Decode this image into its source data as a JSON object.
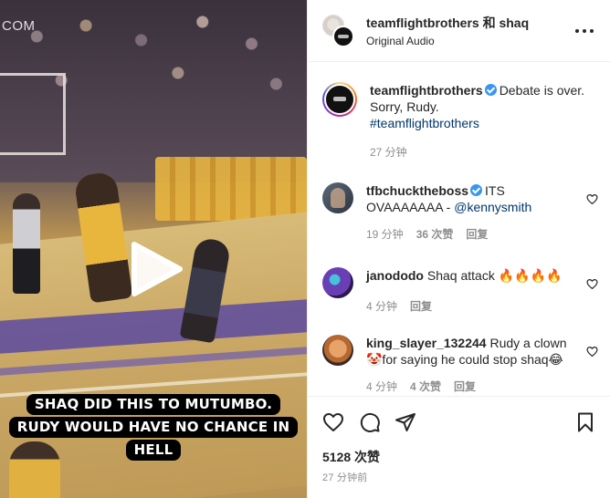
{
  "video": {
    "watermark": "COM",
    "caption_lines": [
      "SHAQ DID THIS TO MUTUMBO.",
      "RUDY WOULD HAVE NO CHANCE IN",
      "HELL"
    ]
  },
  "header": {
    "title": "teamflightbrothers 和 shaq",
    "subtitle": "Original Audio",
    "more_icon": "more-horizontal-icon"
  },
  "caption_post": {
    "username": "teamflightbrothers",
    "text": "Debate is over. Sorry, Rudy.",
    "hashtag": "#teamflightbrothers",
    "time": "27 分钟"
  },
  "comments": [
    {
      "username": "tfbchucktheboss",
      "verified": true,
      "text": "ITS OVAAAAAAA - ",
      "mention": "@kennysmith",
      "time": "19 分钟",
      "likes": "36 次赞",
      "reply": "回复"
    },
    {
      "username": "janododo",
      "verified": false,
      "text": "Shaq attack 🔥🔥🔥🔥",
      "time": "4 分钟",
      "reply": "回复"
    },
    {
      "username": "king_slayer_132244",
      "verified": false,
      "text": "Rudy a clown 🤡for saying he could stop shaq😂",
      "time": "4 分钟",
      "likes": "4 次赞",
      "reply": "回复"
    }
  ],
  "actions": {
    "like_count": "5128 次赞",
    "posted": "27 分钟前"
  },
  "colors": {
    "link": "#00376b",
    "verified": "#3897f0",
    "muted": "#8e8e8e"
  }
}
